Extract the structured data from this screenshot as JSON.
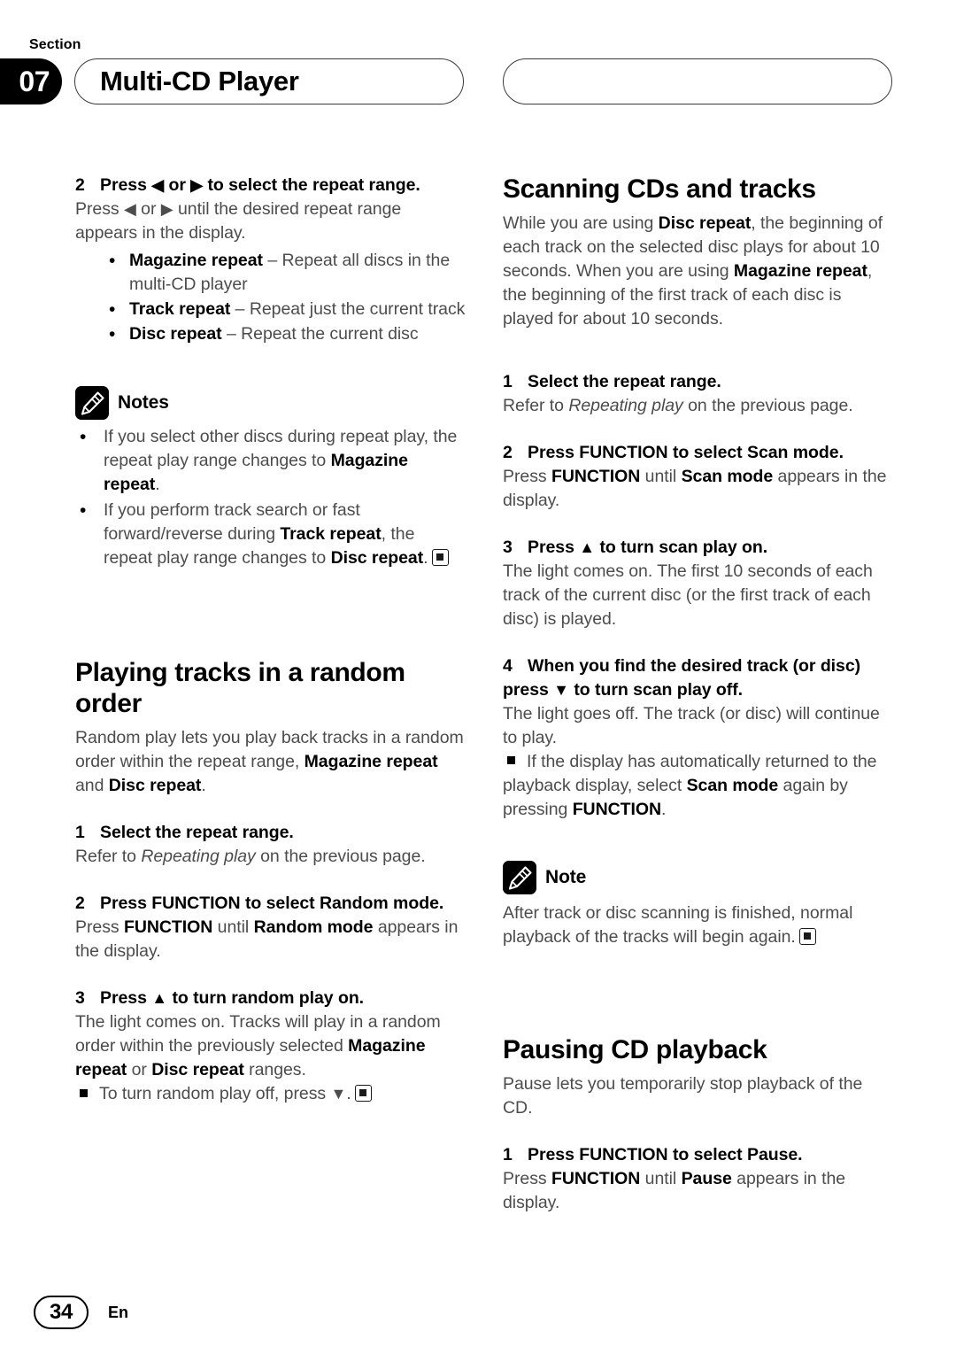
{
  "header": {
    "section_label": "Section",
    "section_number": "07",
    "title": "Multi-CD Player",
    "right_pill_title": ""
  },
  "left_column": {
    "step2": {
      "number": "2",
      "heading_pre": "Press ",
      "heading_arrow_left": "◀",
      "heading_mid": " or ",
      "heading_arrow_right": "▶",
      "heading_post": " to select the repeat range.",
      "body_pre": "Press ",
      "body_arrow_left": "◀",
      "body_mid": " or ",
      "body_arrow_right": "▶",
      "body_post": " until the desired repeat range appears in the display."
    },
    "repeat_ranges": [
      {
        "term": "Magazine repeat",
        "dash": " – ",
        "desc": "Repeat all discs in the multi-CD player"
      },
      {
        "term": "Track repeat",
        "dash": " – ",
        "desc": "Repeat just the current track"
      },
      {
        "term": "Disc repeat",
        "dash": " – ",
        "desc": "Repeat the current disc"
      }
    ],
    "notes": {
      "icon": "pencil-icon",
      "label": "Notes",
      "items": [
        {
          "pre": "If you select other discs during repeat play, the repeat play range changes to ",
          "bold": "Magazine repeat",
          "post": ".",
          "endmark": false
        },
        {
          "pre": "If you perform track search or fast forward/reverse during ",
          "bold": "Track repeat",
          "mid": ", the repeat play range changes to ",
          "bold2": "Disc repeat",
          "post": ".",
          "endmark": true
        }
      ]
    },
    "random_section": {
      "heading": "Playing tracks in a random order",
      "intro_pre": "Random play lets you play back tracks in a random order within the repeat range, ",
      "intro_bold1": "Magazine repeat",
      "intro_mid": " and ",
      "intro_bold2": "Disc repeat",
      "intro_post": ".",
      "step1": {
        "number": "1",
        "heading": "Select the repeat range.",
        "body_pre": "Refer to ",
        "body_italic": "Repeating play",
        "body_post": " on the previous page."
      },
      "step2": {
        "number": "2",
        "heading": "Press FUNCTION to select Random mode.",
        "body_pre": "Press ",
        "body_bold1": "FUNCTION",
        "body_mid": " until ",
        "body_bold2": "Random mode",
        "body_post": " appears in the display."
      },
      "step3": {
        "number": "3",
        "heading_pre": "Press ",
        "heading_arrow": "▲",
        "heading_post": " to turn random play on.",
        "body_pre": "The light comes on. Tracks will play in a random order within the previously selected ",
        "body_bold1": "Magazine repeat",
        "body_mid": " or ",
        "body_bold2": "Disc repeat",
        "body_post": " ranges.",
        "sqnote_pre": "To turn random play off, press ",
        "sqnote_arrow": "▼",
        "sqnote_post": "."
      }
    }
  },
  "right_column": {
    "scanning_section": {
      "heading": "Scanning CDs and tracks",
      "intro_pre": "While you are using ",
      "intro_bold1": "Disc repeat",
      "intro_mid": ", the beginning of each track on the selected disc plays for about 10 seconds. When you are using ",
      "intro_bold2": "Magazine repeat",
      "intro_post": ", the beginning of the first track of each disc is played for about 10 seconds.",
      "step1": {
        "number": "1",
        "heading": "Select the repeat range.",
        "body_pre": "Refer to ",
        "body_italic": "Repeating play",
        "body_post": " on the previous page."
      },
      "step2": {
        "number": "2",
        "heading": "Press FUNCTION to select Scan mode.",
        "body_pre": "Press ",
        "body_bold1": "FUNCTION",
        "body_mid": " until ",
        "body_bold2": "Scan mode",
        "body_post": " appears in the display."
      },
      "step3": {
        "number": "3",
        "heading_pre": "Press ",
        "heading_arrow": "▲",
        "heading_post": " to turn scan play on.",
        "body": "The light comes on. The first 10 seconds of each track of the current disc (or the first track of each disc) is played."
      },
      "step4": {
        "number": "4",
        "heading_pre": "When you find the desired track (or disc) press ",
        "heading_arrow": "▼",
        "heading_post": " to turn scan play off.",
        "body": "The light goes off. The track (or disc) will continue to play.",
        "sqnote_pre": "If the display has automatically returned to the playback display, select ",
        "sqnote_bold1": "Scan mode",
        "sqnote_mid": " again by pressing ",
        "sqnote_bold2": "FUNCTION",
        "sqnote_post": "."
      },
      "note": {
        "icon": "pencil-icon",
        "label": "Note",
        "body": "After track or disc scanning is finished, normal playback of the tracks will begin again."
      }
    },
    "pausing_section": {
      "heading": "Pausing CD playback",
      "intro": "Pause lets you temporarily stop playback of the CD.",
      "step1": {
        "number": "1",
        "heading": "Press FUNCTION to select Pause.",
        "body_pre": "Press ",
        "body_bold1": "FUNCTION",
        "body_mid": " until ",
        "body_bold2": "Pause",
        "body_post": " appears in the display."
      }
    }
  },
  "footer": {
    "page_number": "34",
    "language": "En"
  }
}
